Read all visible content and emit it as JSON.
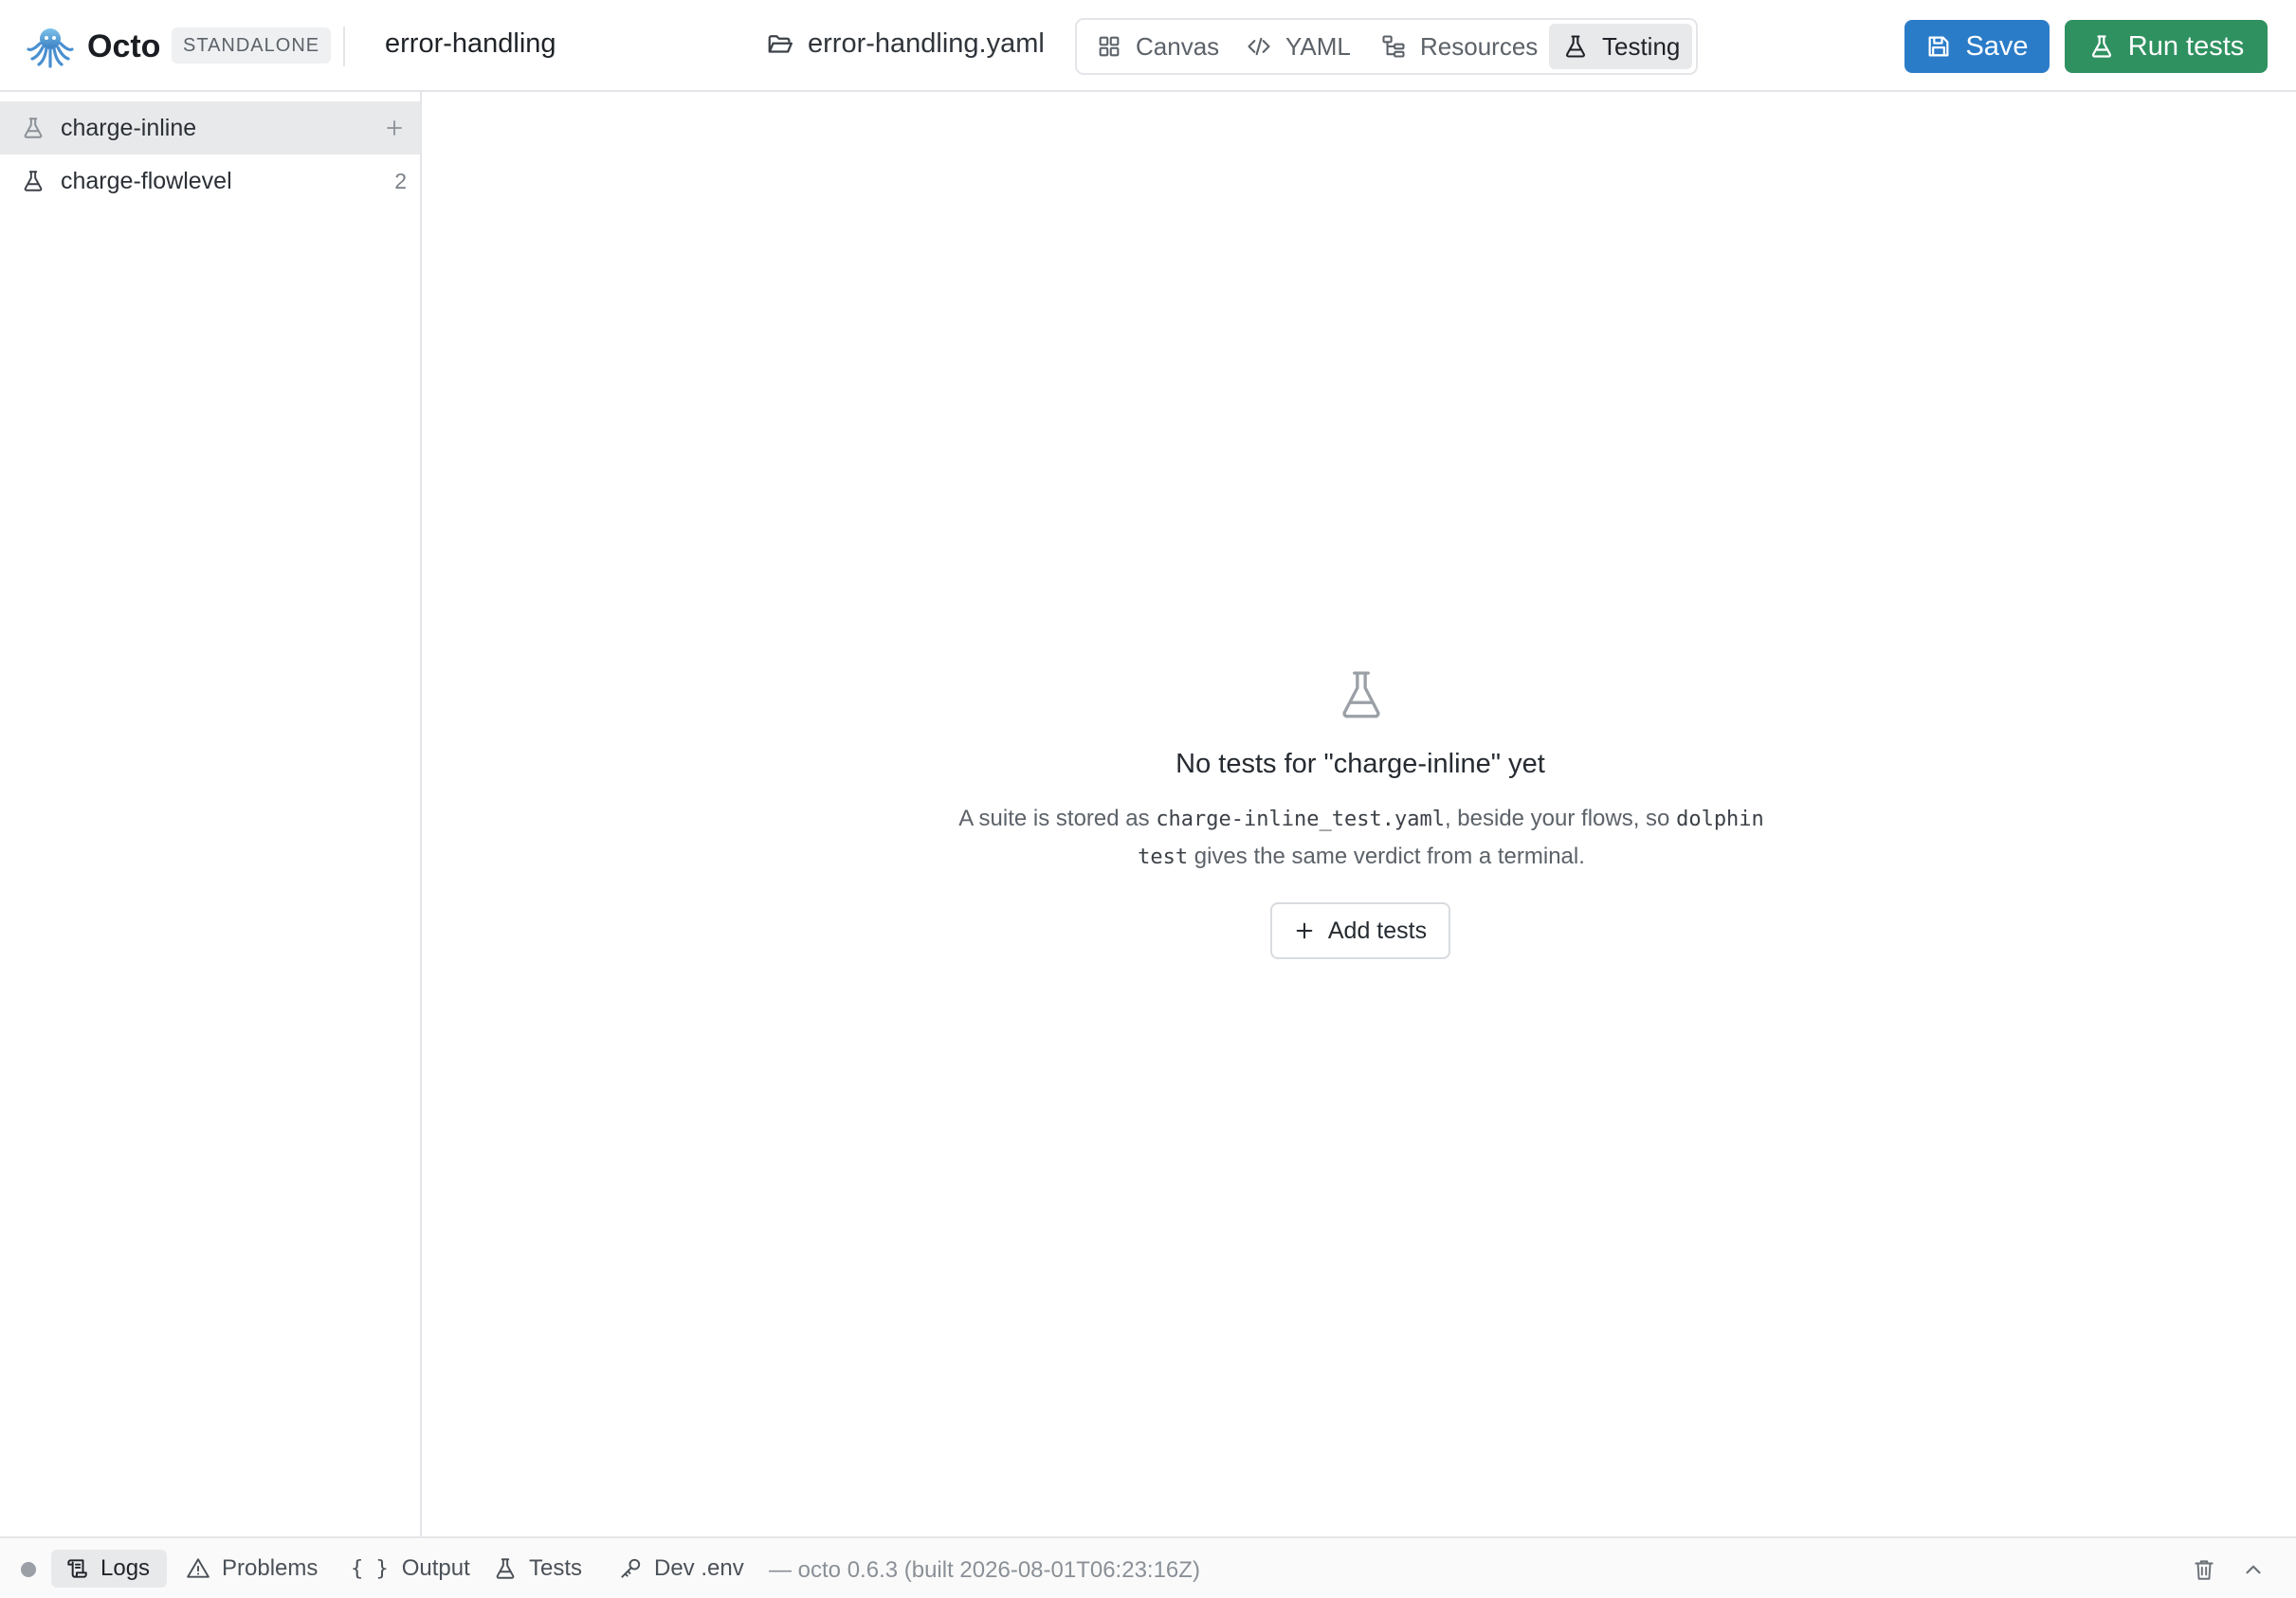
{
  "header": {
    "app_name": "Octo",
    "mode_badge": "STANDALONE",
    "flow_name": "error-handling",
    "file_name": "error-handling.yaml",
    "tabs": [
      {
        "label": "Canvas",
        "icon": "grid-icon"
      },
      {
        "label": "YAML",
        "icon": "code-icon"
      },
      {
        "label": "Resources",
        "icon": "resources-icon"
      },
      {
        "label": "Testing",
        "icon": "flask-icon",
        "active": true
      }
    ],
    "save_label": "Save",
    "run_label": "Run tests"
  },
  "sidebar": {
    "suites": [
      {
        "name": "charge-inline",
        "selected": true
      },
      {
        "name": "charge-flowlevel",
        "count": "2"
      }
    ]
  },
  "empty_state": {
    "title": "No tests for \"charge-inline\" yet",
    "desc_prefix": "A suite is stored as ",
    "desc_file": "charge-inline_test.yaml",
    "desc_middle": ", beside your flows, so ",
    "desc_command": "dolphin test",
    "desc_suffix": " gives the same verdict from a terminal.",
    "add_label": "Add tests"
  },
  "statusbar": {
    "tabs": [
      {
        "label": "Logs",
        "icon": "logs-icon",
        "active": true
      },
      {
        "label": "Problems",
        "icon": "warning-icon"
      },
      {
        "label": "Output",
        "icon": "braces-icon"
      },
      {
        "label": "Tests",
        "icon": "flask-icon"
      },
      {
        "label": "Dev .env",
        "icon": "key-icon"
      }
    ],
    "version": "— octo 0.6.3 (built 2026-08-01T06:23:16Z)"
  },
  "colors": {
    "save": "#2b7cc8",
    "run": "#2f9160",
    "active_tab": "#e8e9eb",
    "border": "#e3e5e8"
  }
}
